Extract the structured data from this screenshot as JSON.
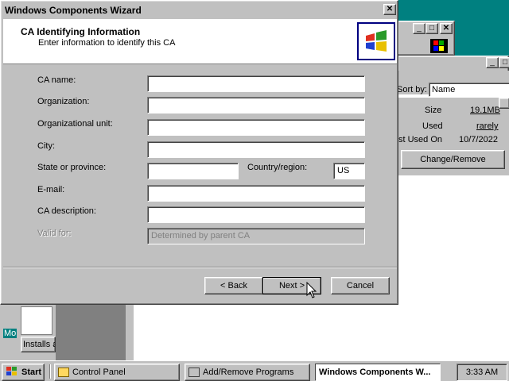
{
  "wizard": {
    "title": "Windows Components Wizard",
    "header_title": "CA Identifying Information",
    "header_subtitle": "Enter information to identify this CA",
    "fields": {
      "ca_name": {
        "label": "CA name:",
        "value": ""
      },
      "organization": {
        "label": "Organization:",
        "value": ""
      },
      "org_unit": {
        "label": "Organizational unit:",
        "value": ""
      },
      "city": {
        "label": "City:",
        "value": ""
      },
      "state": {
        "label": "State or province:",
        "value": ""
      },
      "country": {
        "label": "Country/region:",
        "value": "US"
      },
      "email": {
        "label": "E-mail:",
        "value": ""
      },
      "description": {
        "label": "CA description:",
        "value": ""
      },
      "valid_for": {
        "label": "Valid for:",
        "value": "Determined by parent CA"
      }
    },
    "buttons": {
      "back": "< Back",
      "next": "Next >",
      "cancel": "Cancel"
    }
  },
  "background_window": {
    "sort_by_label": "Sort by:",
    "sort_by_value": "Name",
    "size_label": "Size",
    "size_value": "19.1MB",
    "used_label": "Used",
    "used_value": "rarely",
    "last_used_label": "st Used On",
    "last_used_value": "10/7/2022",
    "change_remove_button": "Change/Remove",
    "left_fragment_1": "Mo",
    "left_fragment_2": "Installs a"
  },
  "taskbar": {
    "start": "Start",
    "tasks": [
      "Control Panel",
      "Add/Remove Programs",
      "Windows Components W..."
    ],
    "clock": "3:33 AM"
  }
}
